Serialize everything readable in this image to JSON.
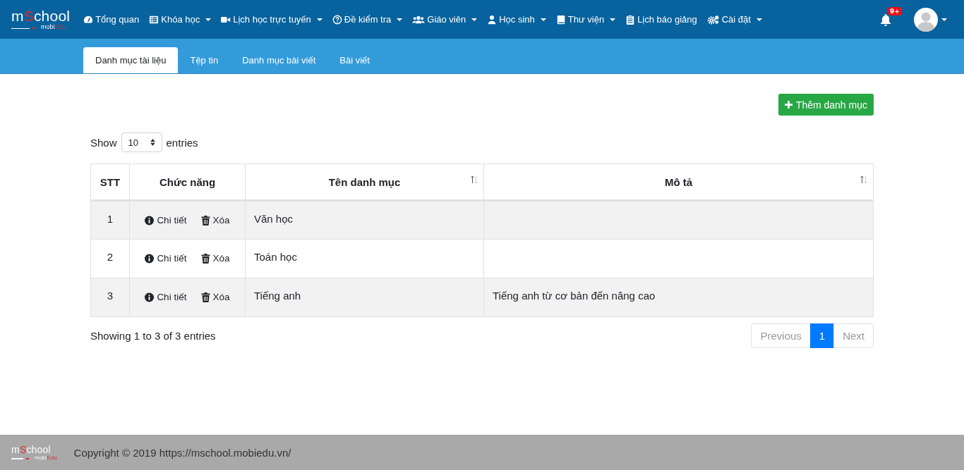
{
  "navbar": {
    "logo": {
      "main_prefix": "m",
      "main_accent": "S",
      "main_rest": "chool",
      "sub_prefix": "mobi",
      "sub_accent": "Edu"
    },
    "items": [
      {
        "label": "Tổng quan",
        "kind": "gauge",
        "dropdown": false
      },
      {
        "label": "Khóa học",
        "kind": "list",
        "dropdown": true
      },
      {
        "label": "Lịch học trực tuyến",
        "kind": "video",
        "dropdown": true
      },
      {
        "label": "Đề kiểm tra",
        "kind": "question",
        "dropdown": true
      },
      {
        "label": "Giáo viên",
        "kind": "users",
        "dropdown": true
      },
      {
        "label": "Học sinh",
        "kind": "user",
        "dropdown": true
      },
      {
        "label": "Thư viện",
        "kind": "book",
        "dropdown": true
      },
      {
        "label": "Lịch báo giảng",
        "kind": "clipboard",
        "dropdown": false
      },
      {
        "label": "Cài đặt",
        "kind": "gears",
        "dropdown": true
      }
    ],
    "notification_badge": "9+"
  },
  "tabs": [
    {
      "label": "Danh mục tài liệu",
      "selected": true
    },
    {
      "label": "Tệp tin",
      "selected": false
    },
    {
      "label": "Danh mục bài viết",
      "selected": false
    },
    {
      "label": "Bài viết",
      "selected": false
    }
  ],
  "add_button": "Thêm danh mục",
  "length_menu": {
    "before": "Show",
    "value": "10",
    "after": "entries"
  },
  "table": {
    "columns": [
      {
        "label": "STT",
        "sortable": false
      },
      {
        "label": "Chức năng",
        "sortable": false
      },
      {
        "label": "Tên danh mục",
        "sortable": true
      },
      {
        "label": "Mô tả",
        "sortable": true
      }
    ],
    "rows": [
      {
        "stt": "1",
        "detail": "Chi tiết",
        "delete": "Xóa",
        "name": "Văn học",
        "description": ""
      },
      {
        "stt": "2",
        "detail": "Chi tiết",
        "delete": "Xóa",
        "name": "Toán học",
        "description": ""
      },
      {
        "stt": "3",
        "detail": "Chi tiết",
        "delete": "Xóa",
        "name": "Tiếng anh",
        "description": "Tiếng anh từ cơ bản đến nâng cao"
      }
    ]
  },
  "info": "Showing 1 to 3 of 3 entries",
  "pagination": [
    {
      "label": "Previous",
      "selected": false,
      "disabled": true
    },
    {
      "label": "1",
      "selected": true,
      "disabled": false
    },
    {
      "label": "Next",
      "selected": false,
      "disabled": true
    }
  ],
  "footer": {
    "logo": {
      "main_prefix": "m",
      "main_accent": "S",
      "main_rest": "chool",
      "sub_prefix": "mobi",
      "sub_accent": "Edu"
    },
    "copyright": "Copyright © 2019 https://mschool.mobiedu.vn/"
  }
}
